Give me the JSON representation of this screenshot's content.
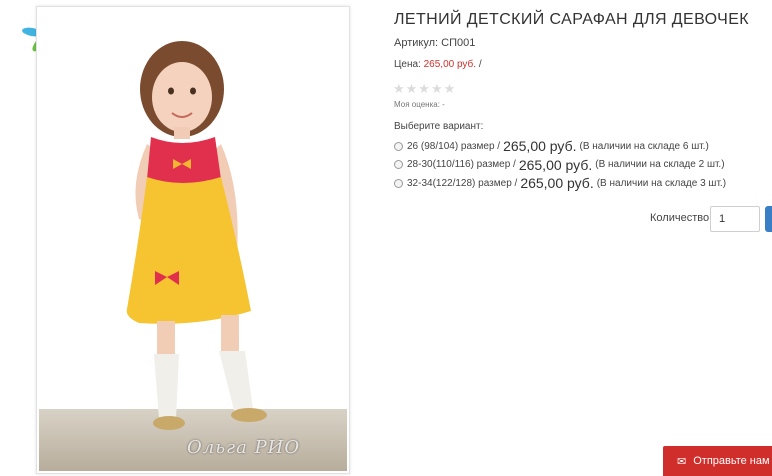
{
  "product": {
    "title": "ЛЕТНИЙ ДЕТСКИЙ САРАФАН ДЛЯ ДЕВОЧЕК",
    "sku_label": "Артикул:",
    "sku_value": "СП001",
    "price_label": "Цена:",
    "price_value": "265,00 руб.",
    "price_suffix": "/",
    "stars": "★★★★★",
    "rating_label": "Моя оценка: -",
    "variant_label": "Выберите вариант:",
    "variants": [
      {
        "size": "26 (98/104) размер /",
        "price": "265,00 руб.",
        "stock": "(В наличии на складе 6 шт.)"
      },
      {
        "size": "28-30(110/116) размер /",
        "price": "265,00 руб.",
        "stock": "(В наличии на складе 2 шт.)"
      },
      {
        "size": "32-34(122/128) размер /",
        "price": "265,00 руб.",
        "stock": "(В наличии на складе 3 шт.)"
      }
    ],
    "quantity_label": "Количество",
    "quantity_value": "1"
  },
  "photo": {
    "watermark": "Ольга РИО"
  },
  "feedback": {
    "label": "Отправьте нам",
    "icon": "mail-icon"
  },
  "colors": {
    "price": "#d0312d",
    "button": "#3a7ec6",
    "feedback_bar": "#cf2e2b",
    "dress": "#f5c430",
    "yoke": "#e0304e"
  }
}
